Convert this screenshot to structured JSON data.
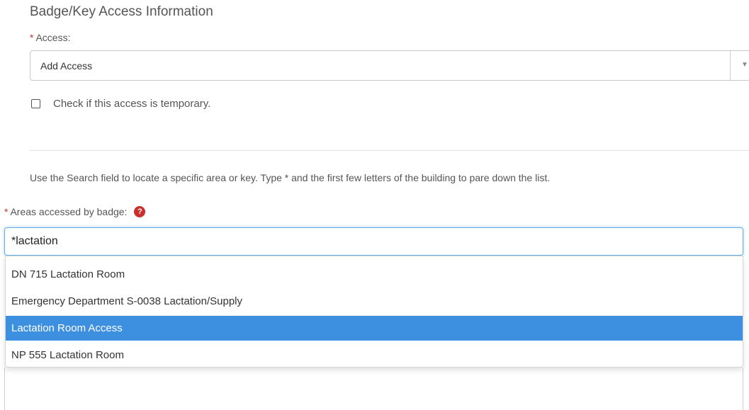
{
  "section": {
    "title": "Badge/Key Access Information"
  },
  "access": {
    "label": "Access:",
    "required_mark": "*",
    "selected": "Add Access",
    "caret": "▼"
  },
  "temporary": {
    "label": "Check if this access is temporary.",
    "checked": false
  },
  "help_text": "Use the Search field to locate a specific area or key. Type * and the first few letters of the building to pare down the list.",
  "badge_areas": {
    "label": "Areas accessed by badge:",
    "required_mark": "*",
    "help_icon": "?",
    "search_value": "*lactation",
    "options": [
      {
        "label": "DN 715 Lactation Room"
      },
      {
        "label": "Emergency Department S-0038 Lactation/Supply"
      },
      {
        "label": "Lactation Room Access",
        "highlighted": true
      },
      {
        "label": "NP 555 Lactation Room"
      }
    ]
  },
  "colors": {
    "required": "#c0392b",
    "highlight": "#3d8fe0",
    "help_icon": "#c9302c",
    "focus_border": "#66afe9"
  }
}
